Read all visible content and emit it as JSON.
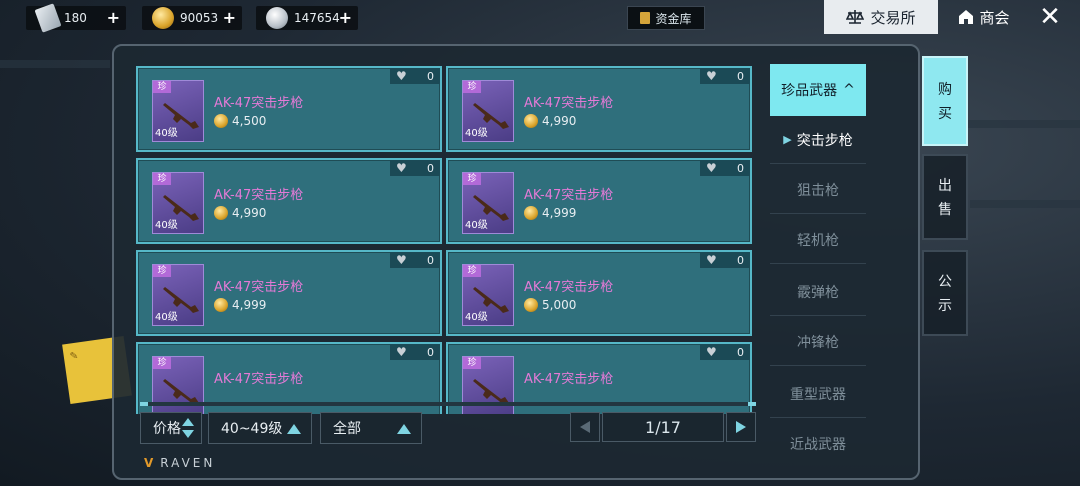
{
  "topbar": {
    "currencies": [
      {
        "icon": "ticket-card-icon",
        "value": "180"
      },
      {
        "icon": "gold-coin-icon",
        "value": "90053"
      },
      {
        "icon": "silver-coin-icon",
        "value": "147654"
      }
    ],
    "plus": "+",
    "vault_label": "资金库",
    "exchange_label": "交易所",
    "shop_label": "商会",
    "close_label": "✕"
  },
  "listings": [
    {
      "name": "AK-47突击步枪",
      "price": "4,500",
      "level": "40级",
      "rarity": "珍",
      "favorites": "0"
    },
    {
      "name": "AK-47突击步枪",
      "price": "4,990",
      "level": "40级",
      "rarity": "珍",
      "favorites": "0"
    },
    {
      "name": "AK-47突击步枪",
      "price": "4,990",
      "level": "40级",
      "rarity": "珍",
      "favorites": "0"
    },
    {
      "name": "AK-47突击步枪",
      "price": "4,999",
      "level": "40级",
      "rarity": "珍",
      "favorites": "0"
    },
    {
      "name": "AK-47突击步枪",
      "price": "4,999",
      "level": "40级",
      "rarity": "珍",
      "favorites": "0"
    },
    {
      "name": "AK-47突击步枪",
      "price": "5,000",
      "level": "40级",
      "rarity": "珍",
      "favorites": "0"
    },
    {
      "name": "AK-47突击步枪",
      "price": "",
      "level": "",
      "rarity": "珍",
      "favorites": "0"
    },
    {
      "name": "AK-47突击步枪",
      "price": "",
      "level": "",
      "rarity": "珍",
      "favorites": "0"
    }
  ],
  "filters": {
    "sort_label": "价格",
    "level_range": "40~49级",
    "scope": "全部"
  },
  "pager": {
    "page": "1/17"
  },
  "brand": "RAVEN",
  "categories": {
    "header": "珍品武器",
    "items": [
      {
        "label": "突击步枪",
        "active": true
      },
      {
        "label": "狙击枪",
        "active": false
      },
      {
        "label": "轻机枪",
        "active": false
      },
      {
        "label": "霰弹枪",
        "active": false
      },
      {
        "label": "冲锋枪",
        "active": false
      },
      {
        "label": "重型武器",
        "active": false
      },
      {
        "label": "近战武器",
        "active": false
      }
    ]
  },
  "side_tabs": {
    "buy": [
      "购",
      "买"
    ],
    "sell": [
      "出",
      "售"
    ],
    "notice": [
      "公",
      "示"
    ]
  },
  "colors": {
    "card_bg": "#2f6f7c",
    "card_border": "#56b8c8",
    "accent": "#7ee8f0",
    "item_name": "#e37ad6"
  }
}
